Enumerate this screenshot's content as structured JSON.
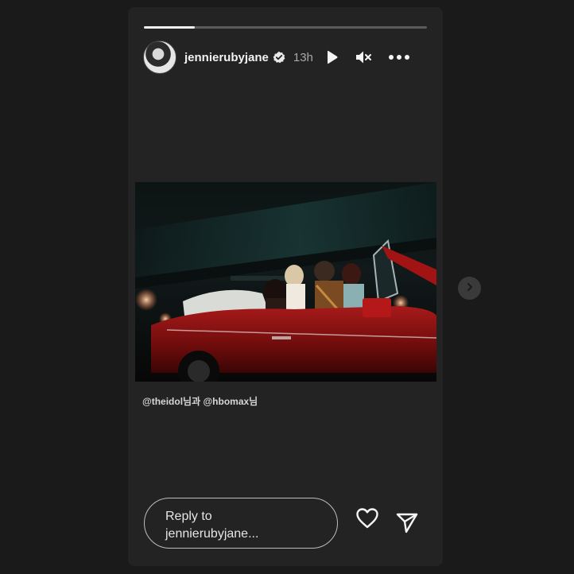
{
  "story": {
    "progress": 0.18,
    "username": "jennierubyjane",
    "time": "13h",
    "caption_prefix": "@theidol",
    "caption_mid": "님과 ",
    "caption_tag2": "@hbomax",
    "caption_suffix": "님",
    "reply_line1": "Reply to",
    "reply_line2": "jennierubyjane..."
  },
  "icons": {
    "verified": "verified-badge-icon",
    "play": "play-icon",
    "mute": "muted-speaker-icon",
    "more": "more-options-icon",
    "heart": "heart-icon",
    "send": "send-icon",
    "next": "chevron-right-icon"
  },
  "colors": {
    "page_bg": "#1a1a1a",
    "panel_bg": "#232323",
    "accent_red": "#8a1414"
  }
}
